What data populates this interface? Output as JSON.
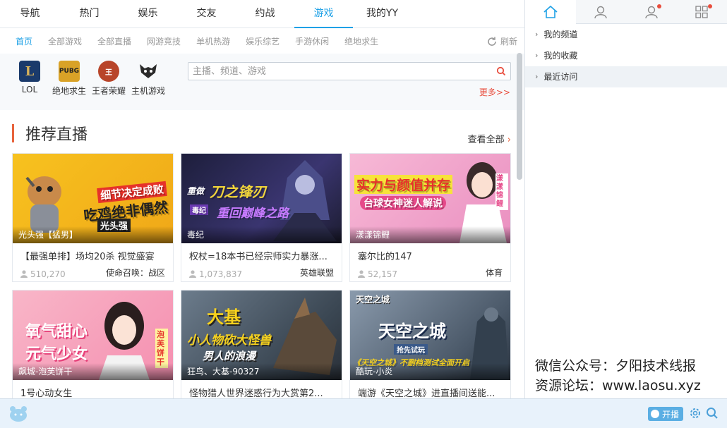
{
  "topnav": {
    "tabs": [
      "导航",
      "热门",
      "娱乐",
      "交友",
      "约战",
      "游戏",
      "我的YY"
    ],
    "active": "游戏"
  },
  "subnav": {
    "items": [
      "首页",
      "全部游戏",
      "全部直播",
      "网游竞技",
      "单机热游",
      "娱乐综艺",
      "手游休闲",
      "绝地求生"
    ],
    "active": "首页",
    "refresh_label": "刷新"
  },
  "games": [
    {
      "name": "LOL",
      "icon": "lol-icon",
      "color": "#1a3a6b",
      "abbr": "L"
    },
    {
      "name": "绝地求生",
      "icon": "pubg-icon",
      "color": "#d9a227",
      "abbr": "PUBG"
    },
    {
      "name": "王者荣耀",
      "icon": "honor-of-kings-icon",
      "color": "#b8452a",
      "abbr": "王"
    },
    {
      "name": "主机游戏",
      "icon": "console-game-icon",
      "color": "#333333",
      "abbr": "◆"
    }
  ],
  "search": {
    "placeholder": "主播、频道、游戏"
  },
  "more_label": "更多>>",
  "section": {
    "title": "推荐直播",
    "view_all": "查看全部"
  },
  "cards": [
    {
      "anchor": "光头强【猛男】",
      "title": "【最强单排】场均20杀 视觉盛宴",
      "views": "510,270",
      "category": "使命召唤：战区",
      "bg": "#f4b51e",
      "text1": "细节决定成败",
      "text2": "吃鸡绝非偶然",
      "text3": "光头强"
    },
    {
      "anchor": "毒纪",
      "title": "权杖=18本书已经宗师实力暴涨...",
      "views": "1,073,837",
      "category": "英雄联盟",
      "bg": "#2c2d52",
      "text1": "重做刀之锋刃",
      "text2": "重回巅峰之路",
      "text3": "毒纪"
    },
    {
      "anchor": "漾漾锦鲤",
      "title": "塞尔比的147",
      "views": "52,157",
      "category": "体育",
      "bg": "#f2a4c8",
      "text1": "实力与颜值并存",
      "text2": "台球女神迷人解说",
      "text3": "漾漾锦鲤"
    },
    {
      "anchor": "飙城-泡芙饼干",
      "title": "1号心动女生",
      "views": "",
      "category": "",
      "bg": "#f59bb8",
      "text1": "氧气甜心",
      "text2": "元气少女",
      "text3": "泡芙饼干"
    },
    {
      "anchor": "狂鸟、大基-90327",
      "title": "怪物猎人世界迷惑行为大赏第2...",
      "views": "",
      "category": "",
      "bg": "#4a5a6a",
      "text1": "大基",
      "text2": "小人物砍大怪兽",
      "text3": "男人的浪漫"
    },
    {
      "anchor": "酷玩-小炎",
      "title": "端游《天空之城》进直播间送能...",
      "views": "",
      "category": "",
      "bg": "#6a7a8c",
      "text1": "天空之城",
      "text2": "抢先试玩",
      "text3": "《天空之城》不删档测试全面开启"
    }
  ],
  "right": {
    "tabs": [
      {
        "icon": "home-icon",
        "active": true,
        "dot": false
      },
      {
        "icon": "user-icon",
        "active": false,
        "dot": false
      },
      {
        "icon": "user-notify-icon",
        "active": false,
        "dot": true
      },
      {
        "icon": "apps-grid-icon",
        "active": false,
        "dot": true
      }
    ],
    "items": [
      "我的频道",
      "我的收藏",
      "最近访问"
    ]
  },
  "watermark": {
    "line1": "微信公众号：夕阳技术线报",
    "line2": "资源论坛：www.laosu.xyz"
  },
  "bottombar": {
    "open_label": "开播"
  }
}
